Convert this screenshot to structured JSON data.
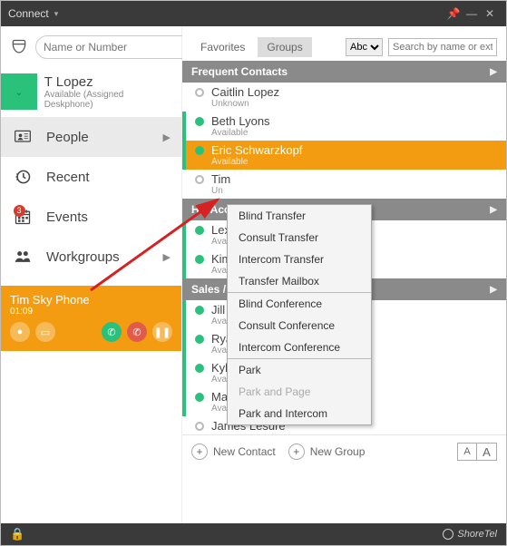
{
  "window": {
    "title": "Connect"
  },
  "search": {
    "placeholder": "Name or Number"
  },
  "user": {
    "name": "T Lopez",
    "status": "Available (Assigned Deskphone)"
  },
  "nav": {
    "people": "People",
    "recent": "Recent",
    "events": "Events",
    "events_badge": "3",
    "workgroups": "Workgroups"
  },
  "call": {
    "name": "Tim Sky Phone",
    "time": "01:09"
  },
  "tabs": {
    "favorites": "Favorites",
    "groups": "Groups",
    "sort": "Abc",
    "filter_placeholder": "Search by name or ext"
  },
  "sections": {
    "frequent": "Frequent Contacts",
    "hr": "HR/Acco",
    "sales": "Sales / M"
  },
  "contacts": {
    "c1": {
      "name": "Caitlin Lopez",
      "status": "Unknown"
    },
    "c2": {
      "name": "Beth Lyons",
      "status": "Available"
    },
    "c3": {
      "name": "Eric Schwarzkopf",
      "status": "Available"
    },
    "c4": {
      "name": "Tim",
      "status": "Un"
    },
    "c5": {
      "name": "Lexie K",
      "status": "Available"
    },
    "c6": {
      "name": "Kimbe",
      "status": "Availa"
    },
    "c7": {
      "name": "Jill Far",
      "status": "Available"
    },
    "c8": {
      "name": "Ryan G",
      "status": "Available"
    },
    "c9": {
      "name": "Kyle H",
      "status": "Availabl"
    },
    "c10": {
      "name": "Maury Huiard",
      "status": "Available"
    },
    "c11": {
      "name": "James Lesure",
      "status": ""
    }
  },
  "menu": {
    "m1": "Blind Transfer",
    "m2": "Consult Transfer",
    "m3": "Intercom Transfer",
    "m4": "Transfer Mailbox",
    "m5": "Blind Conference",
    "m6": "Consult Conference",
    "m7": "Intercom Conference",
    "m8": "Park",
    "m9": "Park and Page",
    "m10": "Park and Intercom"
  },
  "bottom": {
    "new_contact": "New Contact",
    "new_group": "New Group",
    "a1": "A",
    "a2": "A"
  },
  "brand": "ShoreTel"
}
